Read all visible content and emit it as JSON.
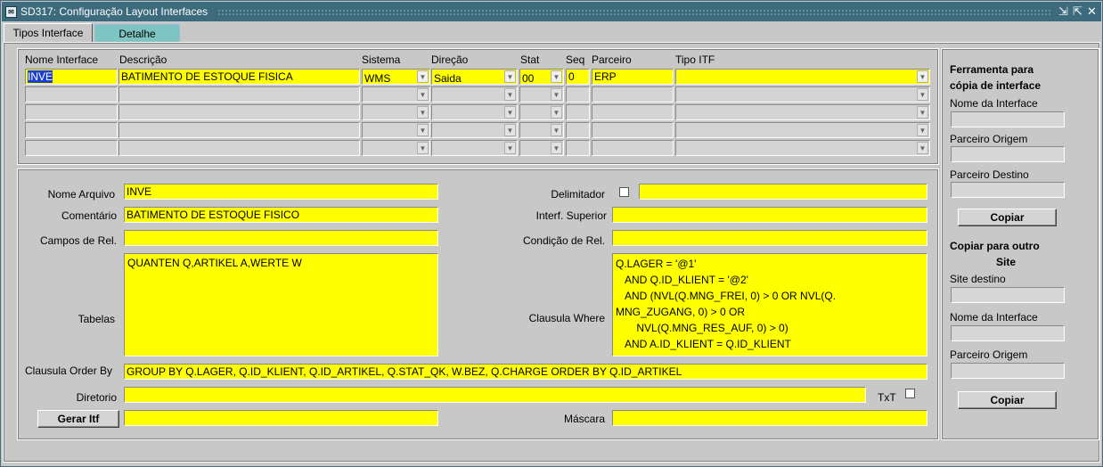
{
  "window": {
    "title": "SD317: Configuração Layout Interfaces"
  },
  "tabs": [
    {
      "label": "Tipos Interface"
    },
    {
      "label": "Detalhe"
    }
  ],
  "grid": {
    "headers": {
      "nome": "Nome Interface",
      "descricao": "Descrição",
      "sistema": "Sistema",
      "direcao": "Direção",
      "stat": "Stat",
      "seq": "Seq",
      "parceiro": "Parceiro",
      "tipo": "Tipo ITF"
    },
    "row1": {
      "nome": "INVE",
      "descricao": "BATIMENTO DE ESTOQUE FISICA",
      "sistema": "WMS",
      "direcao": "Saida",
      "stat": "00",
      "seq": "0",
      "parceiro": "ERP",
      "tipo": ""
    }
  },
  "detail": {
    "nome_arquivo": {
      "label": "Nome Arquivo",
      "value": "INVE"
    },
    "comentario": {
      "label": "Comentário",
      "value": "BATIMENTO DE ESTOQUE FISICO"
    },
    "campos_rel": {
      "label": "Campos de Rel.",
      "value": ""
    },
    "tabelas": {
      "label": "Tabelas",
      "value": "QUANTEN Q,ARTIKEL A,WERTE W"
    },
    "delimitador": {
      "label": "Delimitador",
      "value": ""
    },
    "interf_superior": {
      "label": "Interf. Superior",
      "value": ""
    },
    "condicao_rel": {
      "label": "Condição de Rel.",
      "value": ""
    },
    "clausula_where": {
      "label": "Clausula Where",
      "value": "Q.LAGER = '@1'\n   AND Q.ID_KLIENT = '@2'\n   AND (NVL(Q.MNG_FREI, 0) > 0 OR NVL(Q.\nMNG_ZUGANG, 0) > 0 OR\n       NVL(Q.MNG_RES_AUF, 0) > 0)\n   AND A.ID_KLIENT = Q.ID_KLIENT"
    },
    "order_by": {
      "label": "Clausula Order By",
      "value": "GROUP BY Q.LAGER, Q.ID_KLIENT, Q.ID_ARTIKEL, Q.STAT_QK, W.BEZ, Q.CHARGE ORDER BY Q.ID_ARTIKEL"
    },
    "diretorio": {
      "label": "Diretorio",
      "value": ""
    },
    "txt": {
      "label": "TxT"
    },
    "gerar_itf": {
      "label": "Gerar Itf",
      "value": ""
    },
    "mascara": {
      "label": "Máscara",
      "value": ""
    }
  },
  "sidebar": {
    "tool_title": "Ferramenta para cópia de interface",
    "nome_interface": "Nome da Interface",
    "parceiro_origem": "Parceiro Origem",
    "parceiro_destino": "Parceiro Destino",
    "copiar": "Copiar",
    "copy_site_title_1": "Copiar para outro",
    "copy_site_title_2": "Site",
    "site_destino": "Site destino",
    "nome_interface_2": "Nome da Interface",
    "parceiro_origem_2": "Parceiro Origem",
    "copiar_2": "Copiar"
  }
}
